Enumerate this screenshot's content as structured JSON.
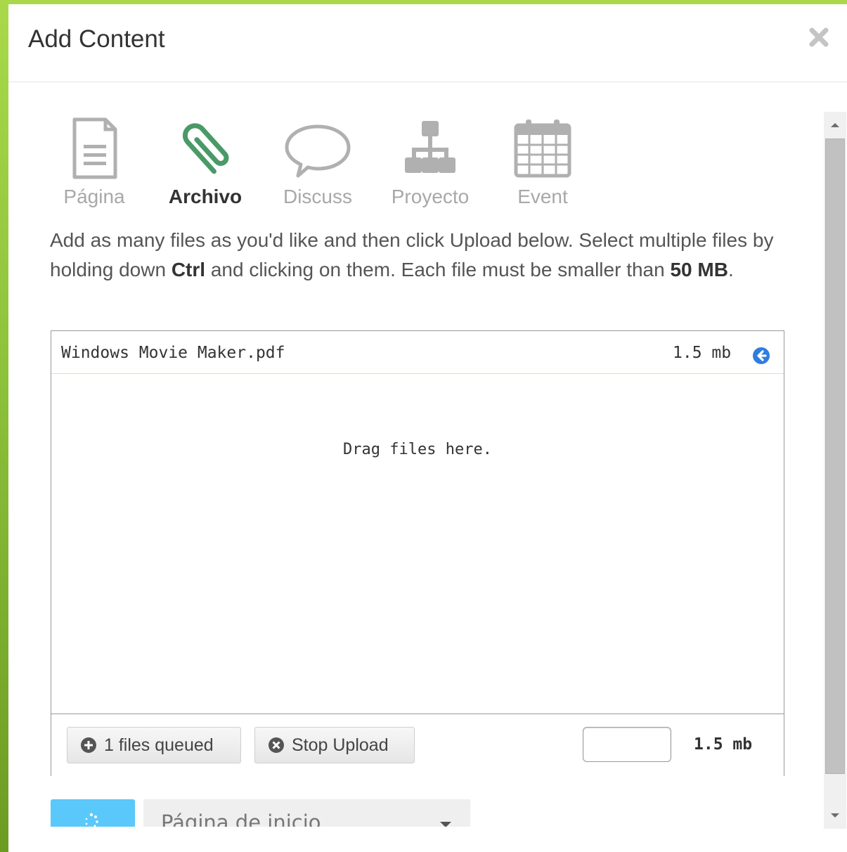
{
  "modal": {
    "title": "Add Content",
    "close_icon": "close-icon"
  },
  "content_types": [
    {
      "label": "Página",
      "icon": "page-icon",
      "active": false
    },
    {
      "label": "Archivo",
      "icon": "paperclip-icon",
      "active": true
    },
    {
      "label": "Discuss",
      "icon": "speech-bubble-icon",
      "active": false
    },
    {
      "label": "Proyecto",
      "icon": "org-chart-icon",
      "active": false
    },
    {
      "label": "Event",
      "icon": "calendar-icon",
      "active": false
    }
  ],
  "description": {
    "part1": "Add as many files as you'd like and then click Upload below. Select multiple files by holding down ",
    "bold1": "Ctrl",
    "part2": " and clicking on them. Each file must be smaller than ",
    "bold2": "50 MB",
    "part3": "."
  },
  "uploader": {
    "file": {
      "name": "Windows Movie Maker.pdf",
      "size": "1.5 mb",
      "remove_icon": "remove-circle-icon"
    },
    "drag_text": "Drag files here.",
    "queued_button": "1 files queued",
    "stop_button": "Stop Upload",
    "total_size": "1.5 mb",
    "progress": 0
  },
  "destination": {
    "selected": "Página de inicio"
  },
  "colors": {
    "accent": "#5ac8fa",
    "active_icon": "#4a9a68",
    "remove_icon": "#2f7de1",
    "inactive": "#a8a8a8"
  }
}
